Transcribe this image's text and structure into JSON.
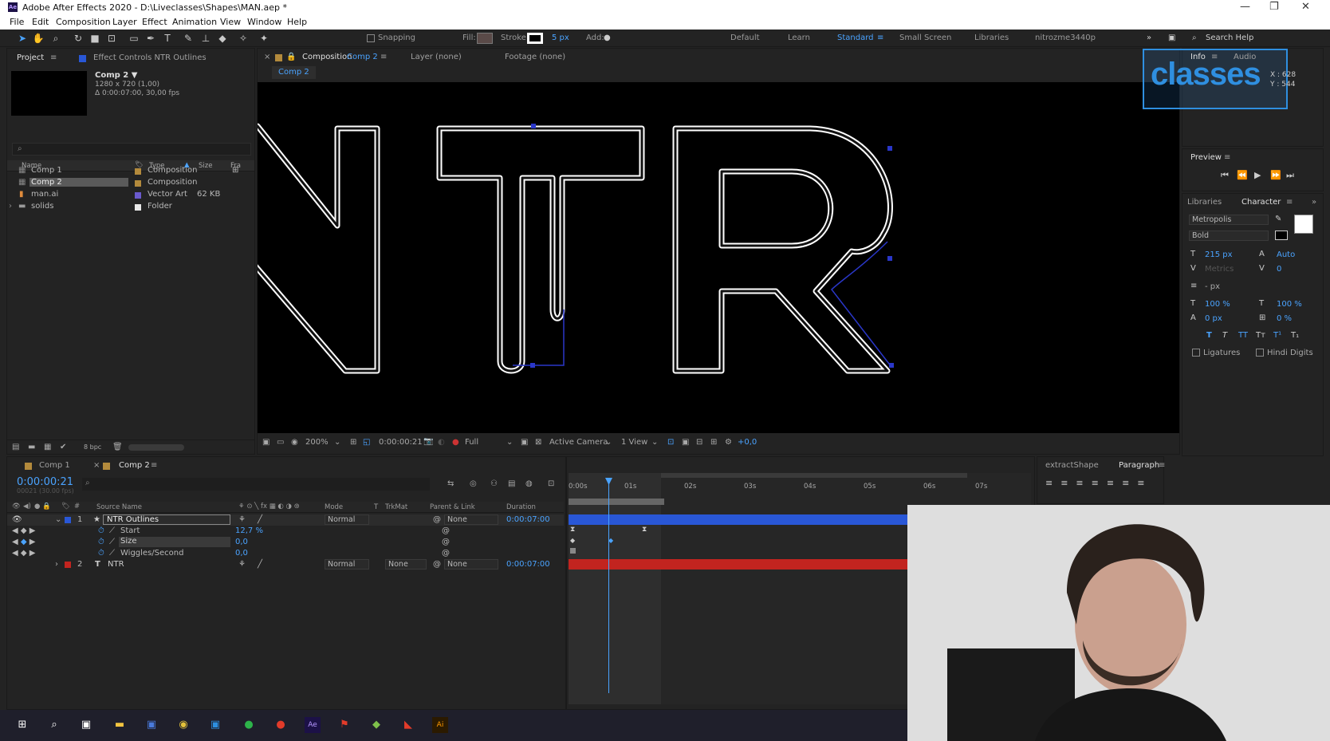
{
  "app": {
    "title": "Adobe After Effects 2020 - D:\\Liveclasses\\Shapes\\MAN.aep *",
    "icon": "ae-icon"
  },
  "menu": [
    "File",
    "Edit",
    "Composition",
    "Layer",
    "Effect",
    "Animation",
    "View",
    "Window",
    "Help"
  ],
  "toolbar": {
    "snapping": "Snapping",
    "fill": "Fill:",
    "stroke": "Stroke:",
    "stroke_width": "5 px",
    "add": "Add:",
    "workspaces": [
      "Default",
      "Learn",
      "Standard",
      "Small Screen",
      "Libraries",
      "nitrozme3440p"
    ],
    "active_workspace": "Standard",
    "search": "Search Help"
  },
  "project": {
    "tab": "Project",
    "effect_controls": "Effect Controls NTR Outlines",
    "comp_name": "Comp 2 ▼",
    "comp_res": "1280 x 720 (1,00)",
    "comp_dur": "Δ 0:00:07:00, 30,00 fps",
    "columns": {
      "name": "Name",
      "type": "Type",
      "size": "Size",
      "frame": "Fra"
    },
    "items": [
      {
        "name": "Comp 1",
        "type": "Composition",
        "size": "",
        "color": "#b38a3c",
        "selected": false
      },
      {
        "name": "Comp 2",
        "type": "Composition",
        "size": "",
        "color": "#b38a3c",
        "selected": true
      },
      {
        "name": "man.ai",
        "type": "Vector Art",
        "size": "62 KB",
        "color": "#6a5acd",
        "selected": false
      },
      {
        "name": "solids",
        "type": "Folder",
        "size": "",
        "color": "#e8e8e8",
        "selected": false
      }
    ],
    "bpc": "8 bpc"
  },
  "composition": {
    "tab": "Composition",
    "tab_comp": "Comp 2",
    "layer": "Layer (none)",
    "footage": "Footage (none)",
    "breadcrumb": "Comp 2",
    "zoom": "200%",
    "timecode": "0:00:00:21",
    "resolution": "Full",
    "camera": "Active Camera",
    "views": "1 View",
    "exposure": "+0,0"
  },
  "info": {
    "tab": "Info",
    "audio": "Audio",
    "x": "X : 628",
    "y": "Y : 544",
    "overlay": "classes"
  },
  "preview": {
    "title": "Preview"
  },
  "character": {
    "libraries": "Libraries",
    "tab": "Character",
    "font": "Metropolis",
    "style": "Bold",
    "size": "215 px",
    "leading": "Auto",
    "kerning": "Metrics",
    "tracking": "0",
    "stroke": "- px",
    "vscale": "100 %",
    "hscale": "100 %",
    "baseline": "0 px",
    "tsume": "0 %",
    "ligatures": "Ligatures",
    "hindi": "Hindi Digits"
  },
  "timeline": {
    "tabs": [
      "Comp 1",
      "Comp 2"
    ],
    "timecode": "0:00:00:21",
    "frames": "00021 (30.00 fps)",
    "columns": {
      "source": "Source Name",
      "mode": "Mode",
      "t": "T",
      "trkmat": "TrkMat",
      "parent": "Parent & Link",
      "duration": "Duration"
    },
    "ruler": [
      "0:00s",
      "01s",
      "02s",
      "03s",
      "04s",
      "05s",
      "06s",
      "07s"
    ],
    "layers": [
      {
        "num": "1",
        "name": "NTR Outlines",
        "mode": "Normal",
        "trkmat": "",
        "parent": "None",
        "duration": "0:00:07:00",
        "color": "#2957d6"
      },
      {
        "num": "2",
        "name": "NTR",
        "mode": "Normal",
        "trkmat": "None",
        "parent": "None",
        "duration": "0:00:07:00",
        "color": "#c2241f"
      }
    ],
    "props": [
      {
        "name": "Start",
        "value": "12,7 %"
      },
      {
        "name": "Size",
        "value": "0,0"
      },
      {
        "name": "Wiggles/Second",
        "value": "0,0"
      }
    ]
  },
  "rightbottom": {
    "extract": "extractShape",
    "paragraph": "Paragraph"
  }
}
